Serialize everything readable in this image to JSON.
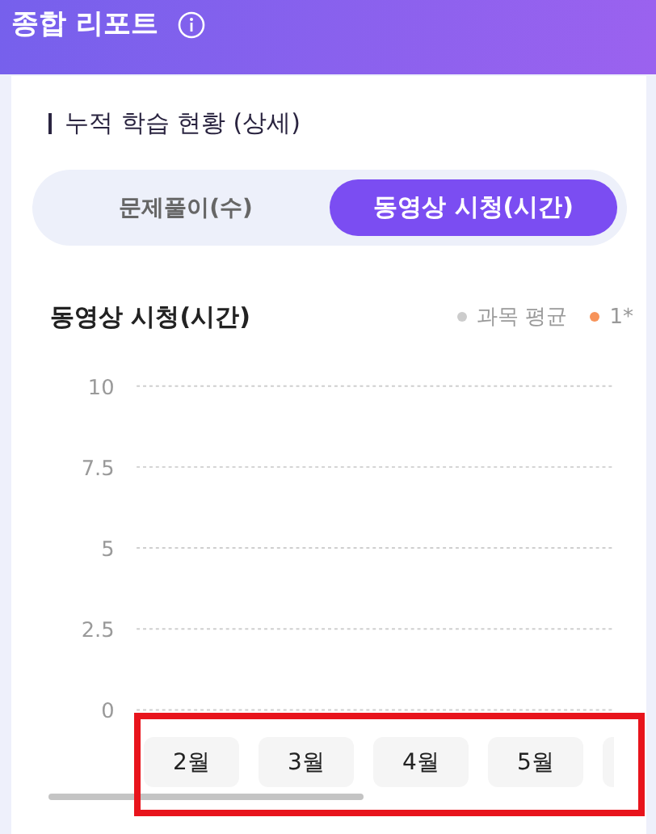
{
  "header": {
    "title": "종합 리포트"
  },
  "section": {
    "title": "누적 학습 현황 (상세)"
  },
  "tabs": [
    {
      "label": "문제풀이(수)",
      "selected": false
    },
    {
      "label": "동영상 시청(시간)",
      "selected": true
    }
  ],
  "chart": {
    "title": "동영상 시청(시간)",
    "chart_data": {
      "type": "line",
      "grid": true,
      "categories": [
        "2월",
        "3월",
        "4월",
        "5월"
      ],
      "ylim": [
        0,
        10
      ],
      "yticks": [
        {
          "value": 0,
          "label": "0"
        },
        {
          "value": 2.5,
          "label": "2.5"
        },
        {
          "value": 5,
          "label": "5"
        },
        {
          "value": 7.5,
          "label": "7.5"
        },
        {
          "value": 10,
          "label": "10"
        }
      ],
      "series": [
        {
          "name": "과목 평균",
          "color": "#cccccc",
          "values": [
            null,
            null,
            null,
            null
          ]
        },
        {
          "name": "1*",
          "color": "#f7935a",
          "values": [
            null,
            null,
            null,
            null
          ]
        }
      ]
    }
  },
  "highlight": {
    "on": true
  }
}
